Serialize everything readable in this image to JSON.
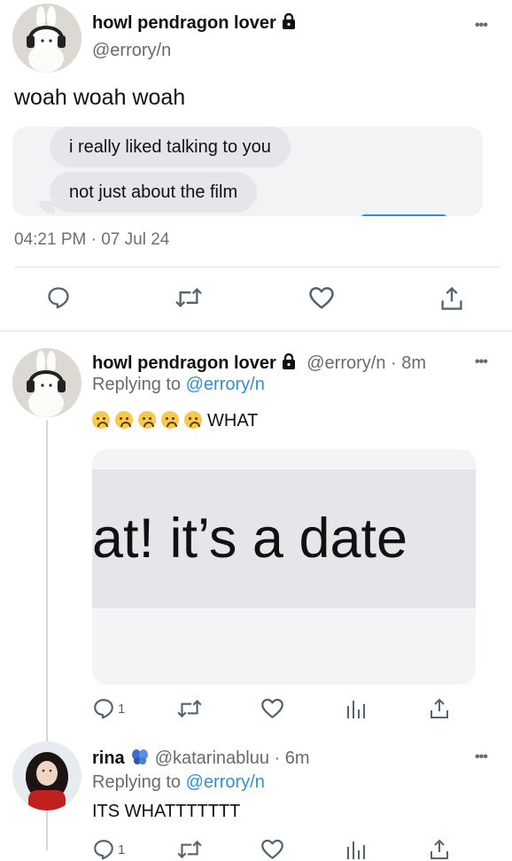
{
  "main_tweet": {
    "name": "howl pendragon lover",
    "handle": "@errory/n",
    "text": "woah woah woah",
    "messages": [
      "i really liked talking to you",
      "not just about the film"
    ],
    "timestamp": "04:21 PM · 07 Jul 24"
  },
  "reply1": {
    "name": "howl pendragon lover",
    "meta": "@errory/n · 8m",
    "replying_prefix": "Replying to",
    "replying_handle": "@errory/n",
    "text": "WHAT",
    "emoji_count": 5,
    "image_text": "at! it’s a date",
    "reply_count": "1"
  },
  "reply2": {
    "name": "rina",
    "meta": "@katarinabluu · 6m",
    "replying_prefix": "Replying to",
    "replying_handle": "@errory/n",
    "text": "ITS WHATTTTTTT",
    "reply_count": "1"
  },
  "icons": {
    "reply": "speech-bubble-icon",
    "retweet": "retweet-icon",
    "like": "heart-icon",
    "share": "share-icon",
    "views": "bar-chart-icon",
    "more": "ellipsis-icon",
    "lock": "lock-icon",
    "verified": "blue-butterfly-icon"
  },
  "colors": {
    "link": "#2d90d8",
    "bubble": "#e5e5ea",
    "muted": "#6b7075"
  }
}
